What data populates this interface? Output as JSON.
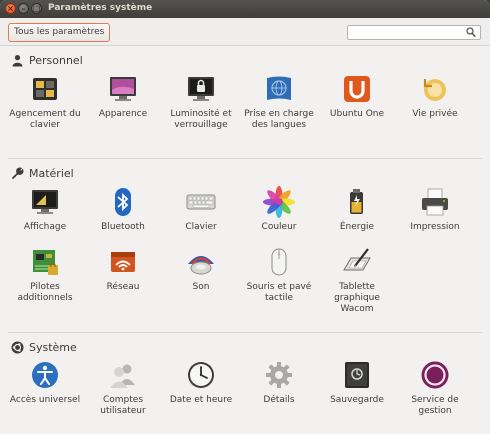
{
  "window": {
    "title": "Paramètres système"
  },
  "toolbar": {
    "all_settings_label": "Tous les paramètres",
    "search_value": "",
    "search_placeholder": ""
  },
  "sections": {
    "personal": {
      "title": "Personnel",
      "items": [
        {
          "label": "Agencement du clavier",
          "icon": "keyboard-layout-icon"
        },
        {
          "label": "Apparence",
          "icon": "appearance-icon"
        },
        {
          "label": "Luminosité et verrouillage",
          "icon": "brightness-lock-icon"
        },
        {
          "label": "Prise en charge des langues",
          "icon": "language-support-icon"
        },
        {
          "label": "Ubuntu One",
          "icon": "ubuntu-one-icon"
        },
        {
          "label": "Vie privée",
          "icon": "privacy-icon"
        }
      ]
    },
    "hardware": {
      "title": "Matériel",
      "items": [
        {
          "label": "Affichage",
          "icon": "display-icon"
        },
        {
          "label": "Bluetooth",
          "icon": "bluetooth-icon"
        },
        {
          "label": "Clavier",
          "icon": "keyboard-icon"
        },
        {
          "label": "Couleur",
          "icon": "color-icon"
        },
        {
          "label": "Énergie",
          "icon": "power-icon"
        },
        {
          "label": "Impression",
          "icon": "printer-icon"
        },
        {
          "label": "Pilotes additionnels",
          "icon": "drivers-icon"
        },
        {
          "label": "Réseau",
          "icon": "network-icon"
        },
        {
          "label": "Son",
          "icon": "sound-icon"
        },
        {
          "label": "Souris et pavé tactile",
          "icon": "mouse-icon"
        },
        {
          "label": "Tablette graphique Wacom",
          "icon": "wacom-tablet-icon"
        }
      ]
    },
    "system": {
      "title": "Système",
      "items": [
        {
          "label": "Accès universel",
          "icon": "universal-access-icon"
        },
        {
          "label": "Comptes utilisateur",
          "icon": "user-accounts-icon"
        },
        {
          "label": "Date et heure",
          "icon": "clock-icon"
        },
        {
          "label": "Détails",
          "icon": "details-icon"
        },
        {
          "label": "Sauvegarde",
          "icon": "backup-icon"
        },
        {
          "label": "Service de gestion",
          "icon": "management-service-icon"
        }
      ]
    }
  },
  "colors": {
    "accent": "#e07a52",
    "titlebar": "#3e3d39",
    "background": "#f2f1f0"
  }
}
